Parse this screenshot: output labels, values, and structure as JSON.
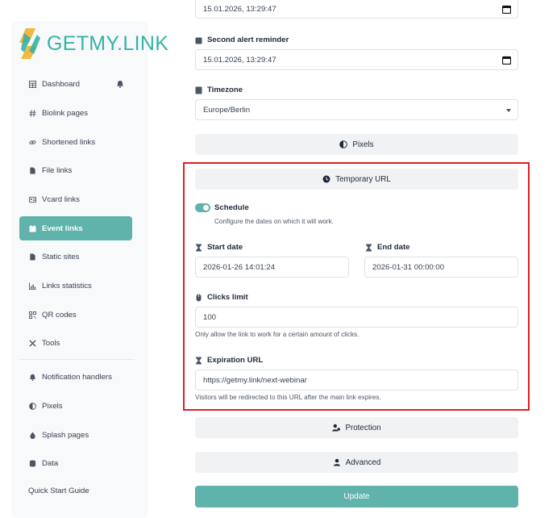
{
  "brand": {
    "name": "GETMY.LINK",
    "accent": "#5fb3aa",
    "logo_color": "#35b3a6"
  },
  "sidebar": {
    "items": [
      {
        "label": "Dashboard",
        "icon": "table-icon"
      },
      {
        "label": "Biolink pages",
        "icon": "hash-icon"
      },
      {
        "label": "Shortened links",
        "icon": "link-icon"
      },
      {
        "label": "File links",
        "icon": "file-icon"
      },
      {
        "label": "Vcard links",
        "icon": "id-card-icon"
      },
      {
        "label": "Event links",
        "icon": "calendar-icon",
        "active": true
      },
      {
        "label": "Static sites",
        "icon": "file-code-icon"
      },
      {
        "label": "Links statistics",
        "icon": "chart-icon"
      },
      {
        "label": "QR codes",
        "icon": "qrcode-icon"
      },
      {
        "label": "Tools",
        "icon": "tools-icon"
      },
      {
        "label": "Notification handlers",
        "icon": "bell-icon"
      },
      {
        "label": "Pixels",
        "icon": "adjust-icon"
      },
      {
        "label": "Splash pages",
        "icon": "droplet-icon"
      },
      {
        "label": "Data",
        "icon": "database-icon"
      }
    ],
    "quick_start": "Quick Start Guide"
  },
  "form": {
    "first_alert_value": "15.01.2026, 13:29:47",
    "second_alert": {
      "label": "Second alert reminder",
      "value": "15.01.2026, 13:29:47"
    },
    "timezone": {
      "label": "Timezone",
      "value": "Europe/Berlin"
    },
    "pixels_label": "Pixels",
    "temporary_url": {
      "title": "Temporary URL",
      "schedule": {
        "label": "Schedule",
        "help": "Configure the dates on which it will work.",
        "enabled": true
      },
      "start_date": {
        "label": "Start date",
        "value": "2026-01-26 14:01:24"
      },
      "end_date": {
        "label": "End date",
        "value": "2026-01-31 00:00:00"
      },
      "clicks_limit": {
        "label": "Clicks limit",
        "value": "100",
        "help": "Only allow the link to work for a certain amount of clicks."
      },
      "expiration_url": {
        "label": "Expiration URL",
        "value": "https://getmy.link/next-webinar",
        "help": "Visitors will be redirected to this URL after the main link expires."
      }
    },
    "protection_label": "Protection",
    "advanced_label": "Advanced",
    "update_label": "Update"
  }
}
